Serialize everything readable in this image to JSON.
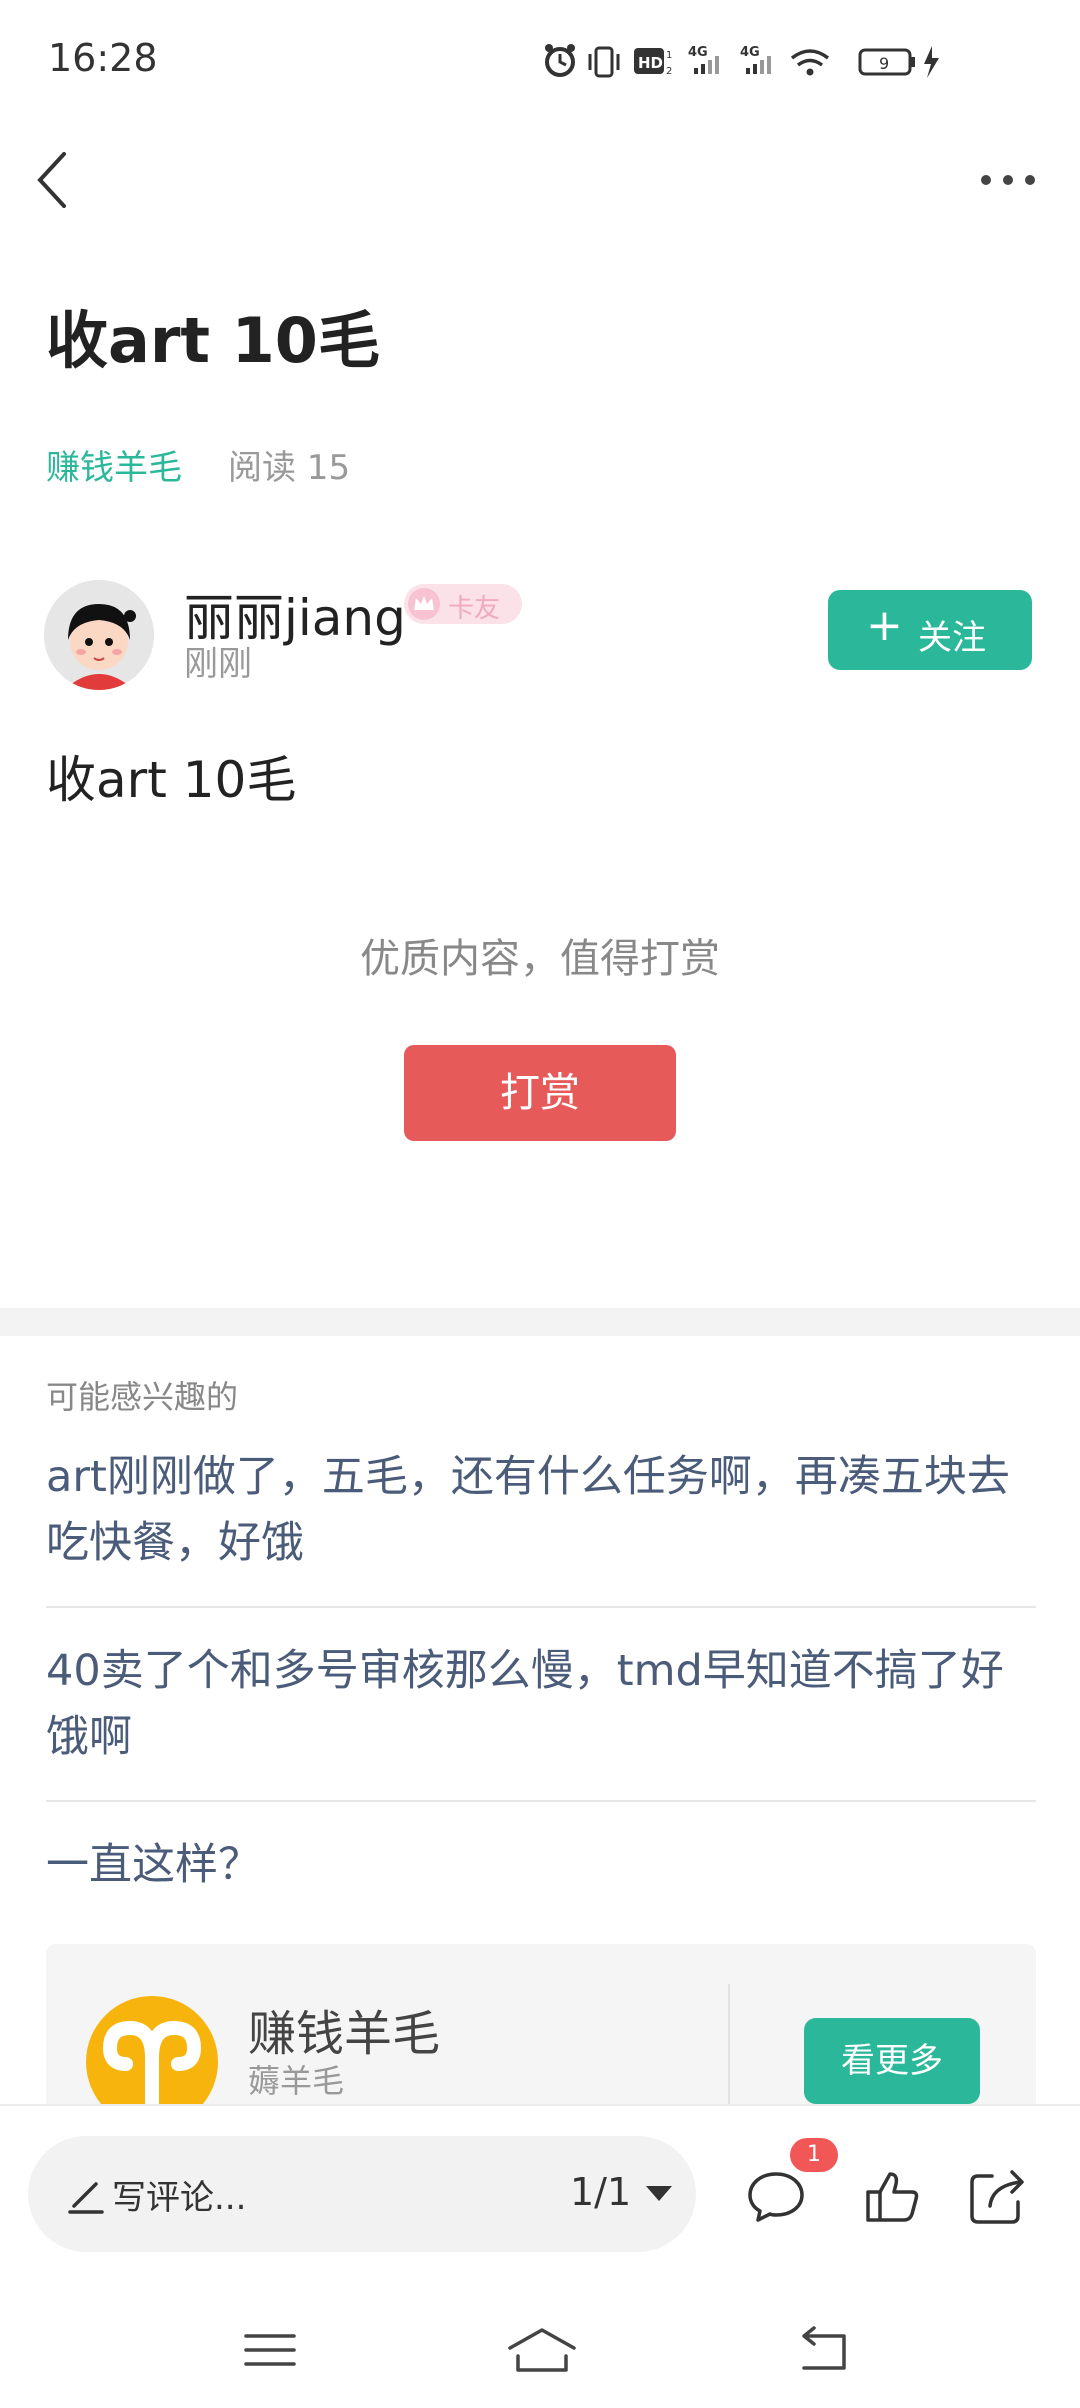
{
  "status_bar": {
    "time": "16:28",
    "battery": "9"
  },
  "post": {
    "title": "收art 10毛",
    "category": "赚钱羊毛",
    "reads": "阅读 15",
    "body": "收art 10毛"
  },
  "author": {
    "name": "丽丽jiang",
    "badge": "卡友",
    "time": "刚刚",
    "follow_label": "关注",
    "follow_plus": "+"
  },
  "reward": {
    "hint": "优质内容，值得打赏",
    "button": "打赏"
  },
  "interest": {
    "title": "可能感兴趣的",
    "items": [
      "art刚刚做了，五毛，还有什么任务啊，再凑五块去吃快餐，好饿",
      "40卖了个和多号审核那么慢，tmd早知道不搞了好饿啊",
      "一直这样？"
    ]
  },
  "card": {
    "title": "赚钱羊毛",
    "subtitle": "薅羊毛",
    "more_button": "看更多"
  },
  "bottom_bar": {
    "comment_placeholder": "写评论...",
    "pager": "1/1",
    "comment_count": "1"
  },
  "colors": {
    "accent": "#2bb89a",
    "reward": "#e65a5a",
    "link": "#4b5c7a",
    "card_logo": "#f6b40d",
    "badge": "#f25757"
  },
  "icons": [
    "back-icon",
    "more-icon",
    "alarm-icon",
    "vibrate-icon",
    "hd-icon",
    "signal-icon",
    "wifi-icon",
    "battery-icon",
    "charging-icon",
    "plus-icon",
    "pencil-icon",
    "caret-down-icon",
    "comment-icon",
    "like-icon",
    "share-icon",
    "menu-icon",
    "home-icon",
    "return-icon",
    "aries-icon"
  ]
}
